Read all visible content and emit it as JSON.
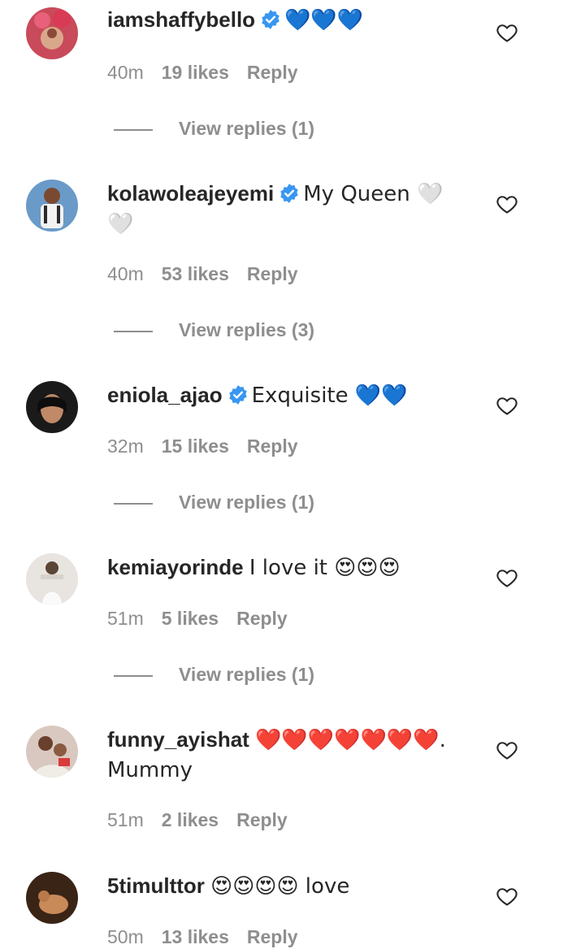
{
  "comments": [
    {
      "username": "iamshaffybello",
      "verified": true,
      "text": "💙💙💙",
      "time": "40m",
      "likes": "19 likes",
      "reply": "Reply",
      "view_replies": "View replies (1)"
    },
    {
      "username": "kolawoleajeyemi",
      "verified": true,
      "text": "My Queen 🤍🤍",
      "time": "40m",
      "likes": "53 likes",
      "reply": "Reply",
      "view_replies": "View replies (3)"
    },
    {
      "username": "eniola_ajao",
      "verified": true,
      "text": "Exquisite 💙💙",
      "time": "32m",
      "likes": "15 likes",
      "reply": "Reply",
      "view_replies": "View replies (1)"
    },
    {
      "username": "kemiayorinde",
      "verified": false,
      "text": "I love it 😍😍😍",
      "time": "51m",
      "likes": "5 likes",
      "reply": "Reply",
      "view_replies": "View replies (1)"
    },
    {
      "username": "funny_ayishat",
      "verified": false,
      "text": "❤️❤️❤️❤️❤️❤️❤️. Mummy",
      "time": "51m",
      "likes": "2 likes",
      "reply": "Reply"
    },
    {
      "username": "5timulttor",
      "verified": false,
      "text": "😍😍😍😍 love",
      "time": "50m",
      "likes": "13 likes",
      "reply": "Reply"
    }
  ],
  "colors": {
    "verified_blue": "#3897f0",
    "meta_gray": "#8e8e8e",
    "text": "#262626"
  }
}
